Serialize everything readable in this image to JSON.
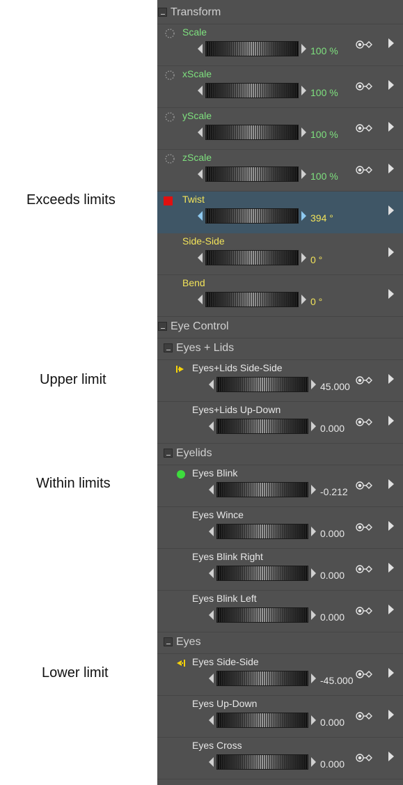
{
  "annotations": [
    {
      "text": "Exceeds limits"
    },
    {
      "text": "Upper limit"
    },
    {
      "text": "Within limits"
    },
    {
      "text": "Lower limit"
    }
  ],
  "colors": {
    "panel_bg": "#505050",
    "exceeds_bg": "#3f5666",
    "green_text": "#7ee07e",
    "yellow_text": "#f2e35a",
    "white_text": "#e8e8e8",
    "red_marker": "#e01010",
    "green_dot": "#3ddc3d",
    "limit_arrow": "#f5d20a"
  },
  "panel": {
    "rows": [
      {
        "kind": "group",
        "level": 0,
        "label": "Transform"
      },
      {
        "kind": "param",
        "style": "top",
        "label": "Scale",
        "value": "100 %",
        "icon": "dotted-circle-icon"
      },
      {
        "kind": "param",
        "style": "top",
        "label": "xScale",
        "value": "100 %",
        "icon": "dotted-circle-icon"
      },
      {
        "kind": "param",
        "style": "top",
        "label": "yScale",
        "value": "100 %",
        "icon": "dotted-circle-icon"
      },
      {
        "kind": "param",
        "style": "top",
        "label": "zScale",
        "value": "100 %",
        "icon": "dotted-circle-icon"
      },
      {
        "kind": "param",
        "style": "twist",
        "label": "Twist",
        "value": "394 °",
        "icon": "red-square-icon",
        "exceeds": true
      },
      {
        "kind": "param",
        "style": "yellow",
        "label": "Side-Side",
        "value": "0 °",
        "icon": "none"
      },
      {
        "kind": "param",
        "style": "yellow",
        "label": "Bend",
        "value": "0 °",
        "icon": "none"
      },
      {
        "kind": "group",
        "level": 0,
        "label": "Eye Control"
      },
      {
        "kind": "group",
        "level": 1,
        "label": "Eyes + Lids"
      },
      {
        "kind": "param",
        "style": "child",
        "label": "Eyes+Lids Side-Side",
        "value": "45.000",
        "icon": "upper-limit-arrow-icon"
      },
      {
        "kind": "param",
        "style": "child",
        "label": "Eyes+Lids Up-Down",
        "value": "0.000",
        "icon": "none"
      },
      {
        "kind": "group",
        "level": 1,
        "label": "Eyelids"
      },
      {
        "kind": "param",
        "style": "child",
        "label": "Eyes Blink",
        "value": "-0.212",
        "icon": "green-dot-icon"
      },
      {
        "kind": "param",
        "style": "child",
        "label": "Eyes Wince",
        "value": "0.000",
        "icon": "none"
      },
      {
        "kind": "param",
        "style": "child",
        "label": "Eyes Blink Right",
        "value": "0.000",
        "icon": "none"
      },
      {
        "kind": "param",
        "style": "child",
        "label": "Eyes Blink Left",
        "value": "0.000",
        "icon": "none"
      },
      {
        "kind": "group",
        "level": 1,
        "label": "Eyes"
      },
      {
        "kind": "param",
        "style": "child",
        "label": "Eyes Side-Side",
        "value": "-45.000",
        "icon": "lower-limit-arrow-icon"
      },
      {
        "kind": "param",
        "style": "child",
        "label": "Eyes Up-Down",
        "value": "0.000",
        "icon": "none"
      },
      {
        "kind": "param",
        "style": "child",
        "label": "Eyes Cross",
        "value": "0.000",
        "icon": "none"
      }
    ]
  }
}
